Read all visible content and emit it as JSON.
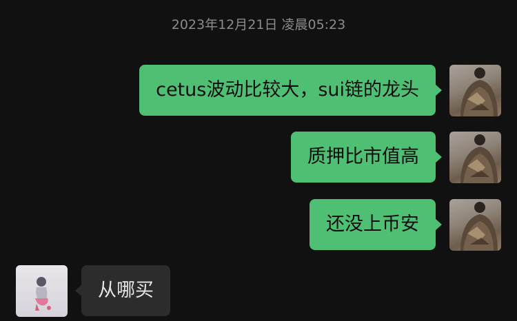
{
  "chat": {
    "timestamp": "2023年12月21日 凌晨05:23",
    "messages": [
      {
        "from": "self",
        "text": "cetus波动比较大，sui链的龙头"
      },
      {
        "from": "self",
        "text": "质押比市值高"
      },
      {
        "from": "self",
        "text": "还没上币安"
      },
      {
        "from": "peer",
        "text": "从哪买"
      }
    ]
  },
  "colors": {
    "background": "#111111",
    "outgoing_bubble": "#4fbf73",
    "incoming_bubble": "#2c2c2c",
    "timestamp_text": "#8c8c8c"
  },
  "icons": {
    "self_avatar": "user-avatar-photo-icon",
    "peer_avatar": "contact-avatar-photo-icon"
  }
}
